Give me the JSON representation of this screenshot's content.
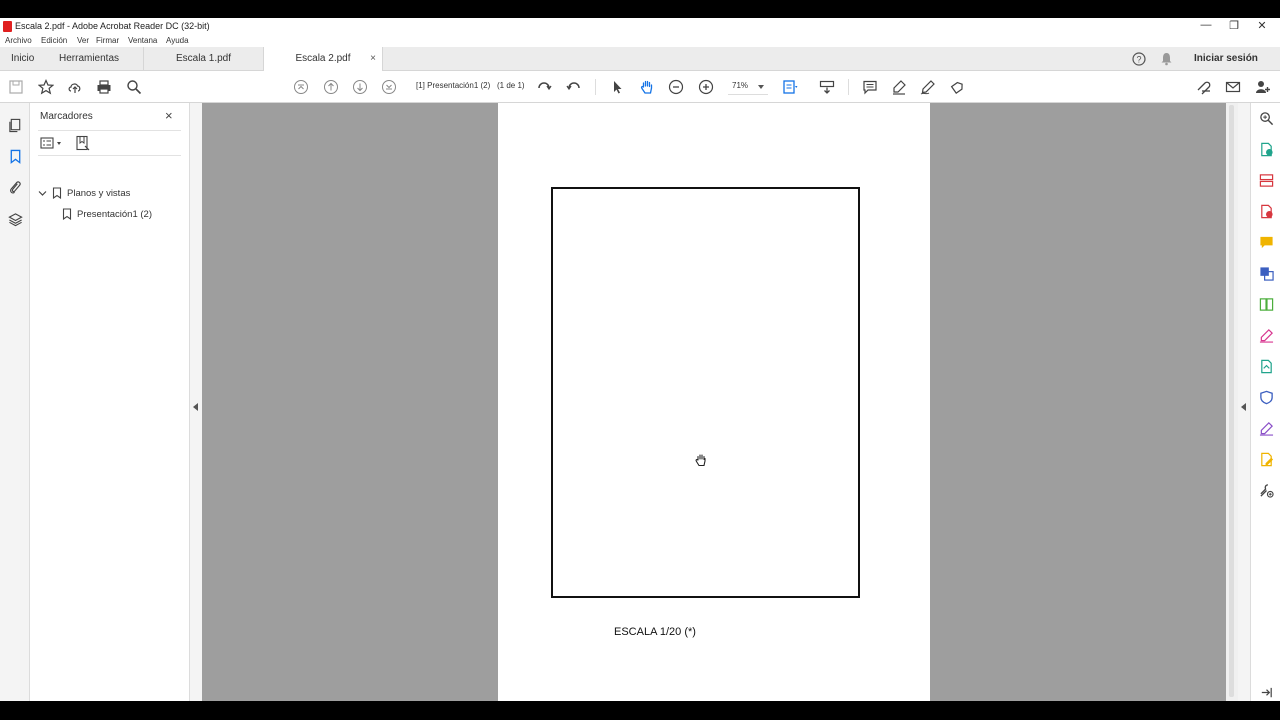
{
  "window": {
    "title": "Escala 2.pdf - Adobe Acrobat Reader DC (32-bit)"
  },
  "menu": [
    "Archivo",
    "Edición",
    "Ver",
    "Firmar",
    "Ventana",
    "Ayuda"
  ],
  "tabs": {
    "home": "Inicio",
    "tools": "Herramientas",
    "doc1": "Escala 1.pdf",
    "doc2": "Escala 2.pdf",
    "close": "×"
  },
  "header": {
    "signin": "Iniciar sesión",
    "help": "?"
  },
  "toolbar": {
    "page_indicator": "[1] Presentación1 (2)",
    "page_count": "(1 de 1)",
    "zoom": "71%"
  },
  "bookmarks": {
    "title": "Marcadores",
    "close": "×",
    "items": [
      {
        "label": "Planos y vistas"
      },
      {
        "label": "Presentación1 (2)"
      }
    ]
  },
  "document": {
    "caption": "ESCALA 1/20 (*)"
  },
  "window_controls": {
    "minimize": "—",
    "maximize": "❐",
    "close": "✕"
  }
}
